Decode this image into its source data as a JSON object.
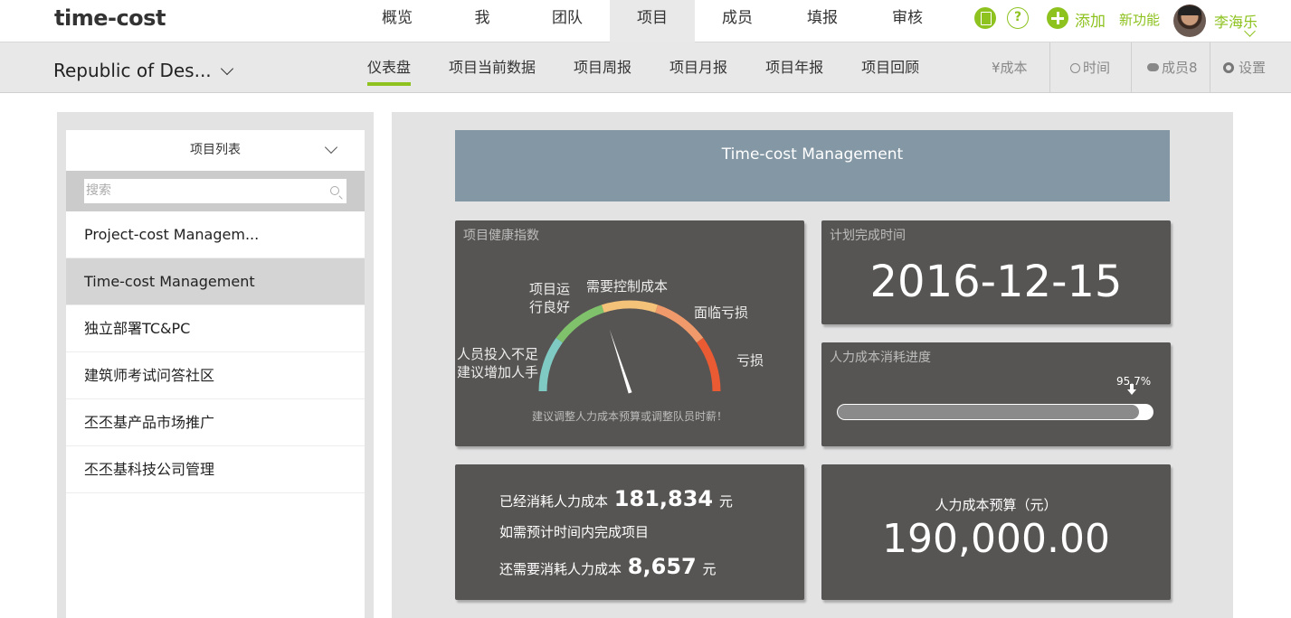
{
  "app": {
    "logo": "time-cost",
    "nav": [
      "概览",
      "我",
      "团队",
      "项目",
      "成员",
      "填报",
      "审核"
    ],
    "nav_active": "项目",
    "add_label": "添加",
    "new_feature_label": "新功能",
    "user_name": "李海乐",
    "help_glyph": "?"
  },
  "subbar": {
    "project_name": "Republic of Des...",
    "tabs": [
      "仪表盘",
      "项目当前数据",
      "项目周报",
      "项目月报",
      "项目年报",
      "项目回顾"
    ],
    "active_tab": "仪表盘",
    "cost_label": "¥成本",
    "time_label": "时间",
    "members_label": "成员8",
    "settings_label": "设置"
  },
  "project_list": {
    "header": "项目列表",
    "search_placeholder": "搜索",
    "items": [
      "Project-cost Managem...",
      "Time-cost Management",
      "独立部署TC&PC",
      "建筑师考试问答社区",
      "丕丕基产品市场推广",
      "丕丕基科技公司管理"
    ],
    "selected_index": 1
  },
  "dashboard": {
    "banner_title": "Time-cost Management",
    "health": {
      "title": "项目健康指数",
      "labels": {
        "understaffed_1": "人员投入不足",
        "understaffed_2": "建议增加人手",
        "good_1": "项目运",
        "good_2": "行良好",
        "control": "需要控制成本",
        "risk": "面临亏损",
        "loss": "亏损"
      },
      "note": "建议调整人力成本预算或调整队员时薪！",
      "needle_value": 0.4,
      "colors": [
        "#7fcbc4",
        "#7fc26b",
        "#f5c27a",
        "#f09a6b",
        "#ea5a33"
      ]
    },
    "deadline": {
      "title": "计划完成时间",
      "value": "2016-12-15"
    },
    "cost_progress": {
      "title": "人力成本消耗进度",
      "label": "95.7%",
      "fraction": 0.957
    },
    "consumption": {
      "line1_prefix": "已经消耗人力成本",
      "line1_value": "181,834",
      "line1_unit": "元",
      "line2": "如需预计时间内完成项目",
      "line3_prefix": "还需要消耗人力成本",
      "line3_value": "8,657",
      "line3_unit": "元"
    },
    "budget": {
      "title": "人力成本预算（元）",
      "value": "190,000.00"
    }
  },
  "colors": {
    "accent": "#8dc21f",
    "card_bg": "#575553",
    "banner_bg": "#8497a4"
  }
}
